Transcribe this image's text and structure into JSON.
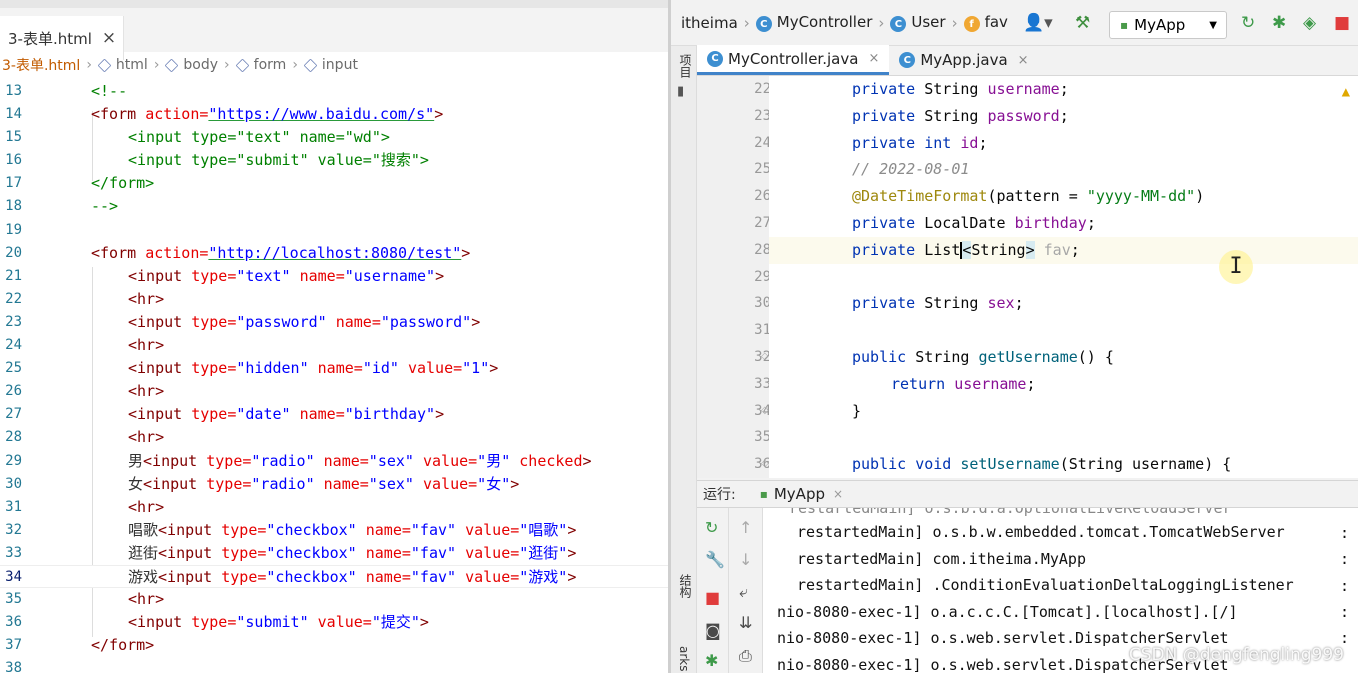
{
  "vscode": {
    "tab": {
      "label": "3-表单.html",
      "close": "×"
    },
    "breadcrumb": [
      "3-表单.html",
      "html",
      "body",
      "form",
      "input"
    ],
    "lines": [
      {
        "n": "13"
      },
      {
        "n": "14"
      },
      {
        "n": "15"
      },
      {
        "n": "16"
      },
      {
        "n": "17"
      },
      {
        "n": "18"
      },
      {
        "n": "19"
      },
      {
        "n": "20"
      },
      {
        "n": "21"
      },
      {
        "n": "22"
      },
      {
        "n": "23"
      },
      {
        "n": "24"
      },
      {
        "n": "25"
      },
      {
        "n": "26"
      },
      {
        "n": "27"
      },
      {
        "n": "28"
      },
      {
        "n": "29"
      },
      {
        "n": "30"
      },
      {
        "n": "31"
      },
      {
        "n": "32"
      },
      {
        "n": "33"
      },
      {
        "n": "34"
      },
      {
        "n": "35"
      },
      {
        "n": "36"
      },
      {
        "n": "37"
      },
      {
        "n": "38"
      }
    ],
    "code": {
      "l13": "<!--",
      "l14_a": "<form ",
      "l14_b": "action=",
      "l14_c": "\"https://www.baidu.com/s\"",
      "l14_d": ">",
      "l15": "<input type=\"text\" name=\"wd\">",
      "l16": "<input type=\"submit\" value=\"搜索\">",
      "l17": "</form>",
      "l18": "-->",
      "l20_a": "<form ",
      "l20_b": "action=",
      "l20_c": "\"http://localhost:8080/test\"",
      "l20_d": ">",
      "input": "<input ",
      "hr": "<hr>",
      "close": ">",
      "endform": "</form>",
      "type": "type=",
      "name": "name=",
      "value": "value=",
      "checked": "checked",
      "v_text": "\"text\"",
      "v_username": "\"username\"",
      "v_password": "\"password\"",
      "v_hidden": "\"hidden\"",
      "v_id": "\"id\"",
      "v_1": "\"1\"",
      "v_date": "\"date\"",
      "v_birthday": "\"birthday\"",
      "v_radio": "\"radio\"",
      "v_sex": "\"sex\"",
      "v_male": "\"男\"",
      "v_female": "\"女\"",
      "v_checkbox": "\"checkbox\"",
      "v_fav": "\"fav\"",
      "v_sing": "\"唱歌\"",
      "v_shop": "\"逛街\"",
      "v_game": "\"游戏\"",
      "v_submit": "\"submit\"",
      "v_commit": "\"提交\"",
      "t_male": "男",
      "t_female": "女",
      "t_sing": "唱歌",
      "t_shop": "逛街",
      "t_game": "游戏"
    }
  },
  "idea": {
    "nav": [
      "itheima",
      "MyController",
      "User",
      "fav"
    ],
    "run_config": "MyApp",
    "editor_tabs": [
      {
        "label": "MyController.java",
        "close": "×"
      },
      {
        "label": "MyApp.java",
        "close": "×"
      }
    ],
    "side_labels": {
      "project": "项目",
      "structure": "结构",
      "bookmarks": "arks"
    },
    "line_numbers": [
      "22",
      "23",
      "24",
      "25",
      "26",
      "27",
      "28",
      "29",
      "30",
      "31",
      "32",
      "33",
      "34",
      "35",
      "36"
    ],
    "java": {
      "private": "private ",
      "public": "public ",
      "return": "return ",
      "int": "int ",
      "void": "void ",
      "String": "String ",
      "LocalDate": "LocalDate ",
      "List": "List",
      "username": "username",
      "password": "password",
      "id": "id",
      "birthday": "birthday",
      "fav": "fav",
      "sex": "sex",
      "semi": ";",
      "comment": "// 2022-08-01",
      "annotation": "@DateTimeFormat",
      "ann_args_a": "(pattern = ",
      "ann_args_b": "\"yyyy-MM-dd\"",
      "ann_args_c": ")",
      "generic_open": "<",
      "generic_type": "String",
      "generic_close": ">",
      "getUsername": "getUsername",
      "setUsername": "setUsername",
      "get_sig": "() {",
      "set_sig": "(String username) {",
      "brace": "}"
    },
    "run_panel": {
      "label": "运行:",
      "tab": "MyApp",
      "close": "×",
      "lines": [
        "restartedMain] o.s.b.w.embedded.tomcat.TomcatWebServer",
        "restartedMain] com.itheima.MyApp",
        "restartedMain] .ConditionEvaluationDeltaLoggingListener",
        "nio-8080-exec-1] o.a.c.c.C.[Tomcat].[localhost].[/]",
        "nio-8080-exec-1] o.s.web.servlet.DispatcherServlet",
        "nio-8080-exec-1] o.s.web.servlet.DispatcherServlet"
      ],
      "col_mark": ":"
    }
  },
  "watermark": "CSDN @dengfengling999",
  "icons": [
    "close-icon",
    "cube-icon",
    "class-icon",
    "field-icon",
    "user-icon",
    "hammer-icon",
    "rerun-icon",
    "debug-icon",
    "coverage-icon",
    "stop-icon",
    "wrench-icon",
    "camera-icon",
    "wrap-icon",
    "scroll-icon",
    "print-icon",
    "arrow-up-icon",
    "arrow-down-icon",
    "warning-icon",
    "fold-icon"
  ],
  "colors": {
    "keyword": "#0033b3",
    "field": "#871094",
    "string": "#067d17",
    "html_tag": "#800000",
    "html_attr": "#e50000",
    "html_value": "#0000ff",
    "comment": "#008000",
    "run_stop": "#e03c3c"
  }
}
